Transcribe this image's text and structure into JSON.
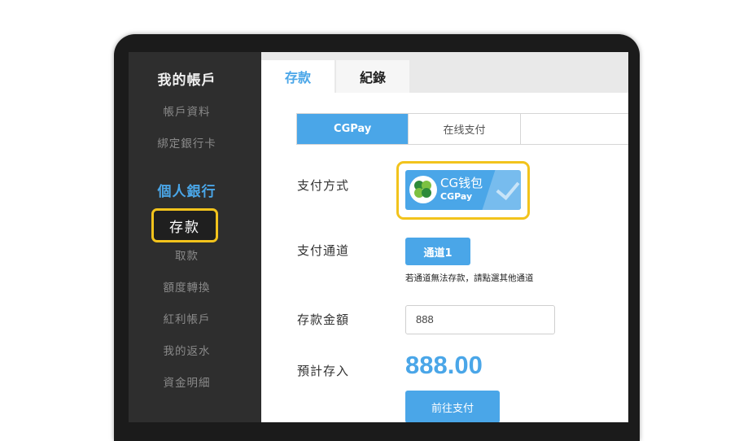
{
  "sidebar": {
    "section_account": "我的帳戶",
    "account_items": [
      "帳戶資料",
      "綁定銀行卡"
    ],
    "section_bank": "個人銀行",
    "active_item": "存款",
    "bank_items": [
      "取款",
      "額度轉換",
      "紅利帳戶",
      "我的返水",
      "資金明細"
    ],
    "colors": {
      "bg": "#2e2e2e",
      "accent": "#4aa6e8",
      "highlight": "#f2c31c"
    }
  },
  "tabs": [
    "存款",
    "紀錄"
  ],
  "subtabs": [
    "CGPay",
    "在线支付"
  ],
  "form": {
    "method_label": "支付方式",
    "method_name": "CG钱包",
    "method_sub": "CGPay",
    "channel_label": "支付通道",
    "channel_button": "通道1",
    "channel_note": "若通道無法存款，請點選其他通道",
    "amount_label": "存款金額",
    "amount_value": "888",
    "expected_label": "預計存入",
    "expected_value": "888.00",
    "submit_label": "前往支付"
  },
  "icons": {
    "method_logo": "cgpay-clover-logo",
    "selected": "checkmark-icon"
  }
}
